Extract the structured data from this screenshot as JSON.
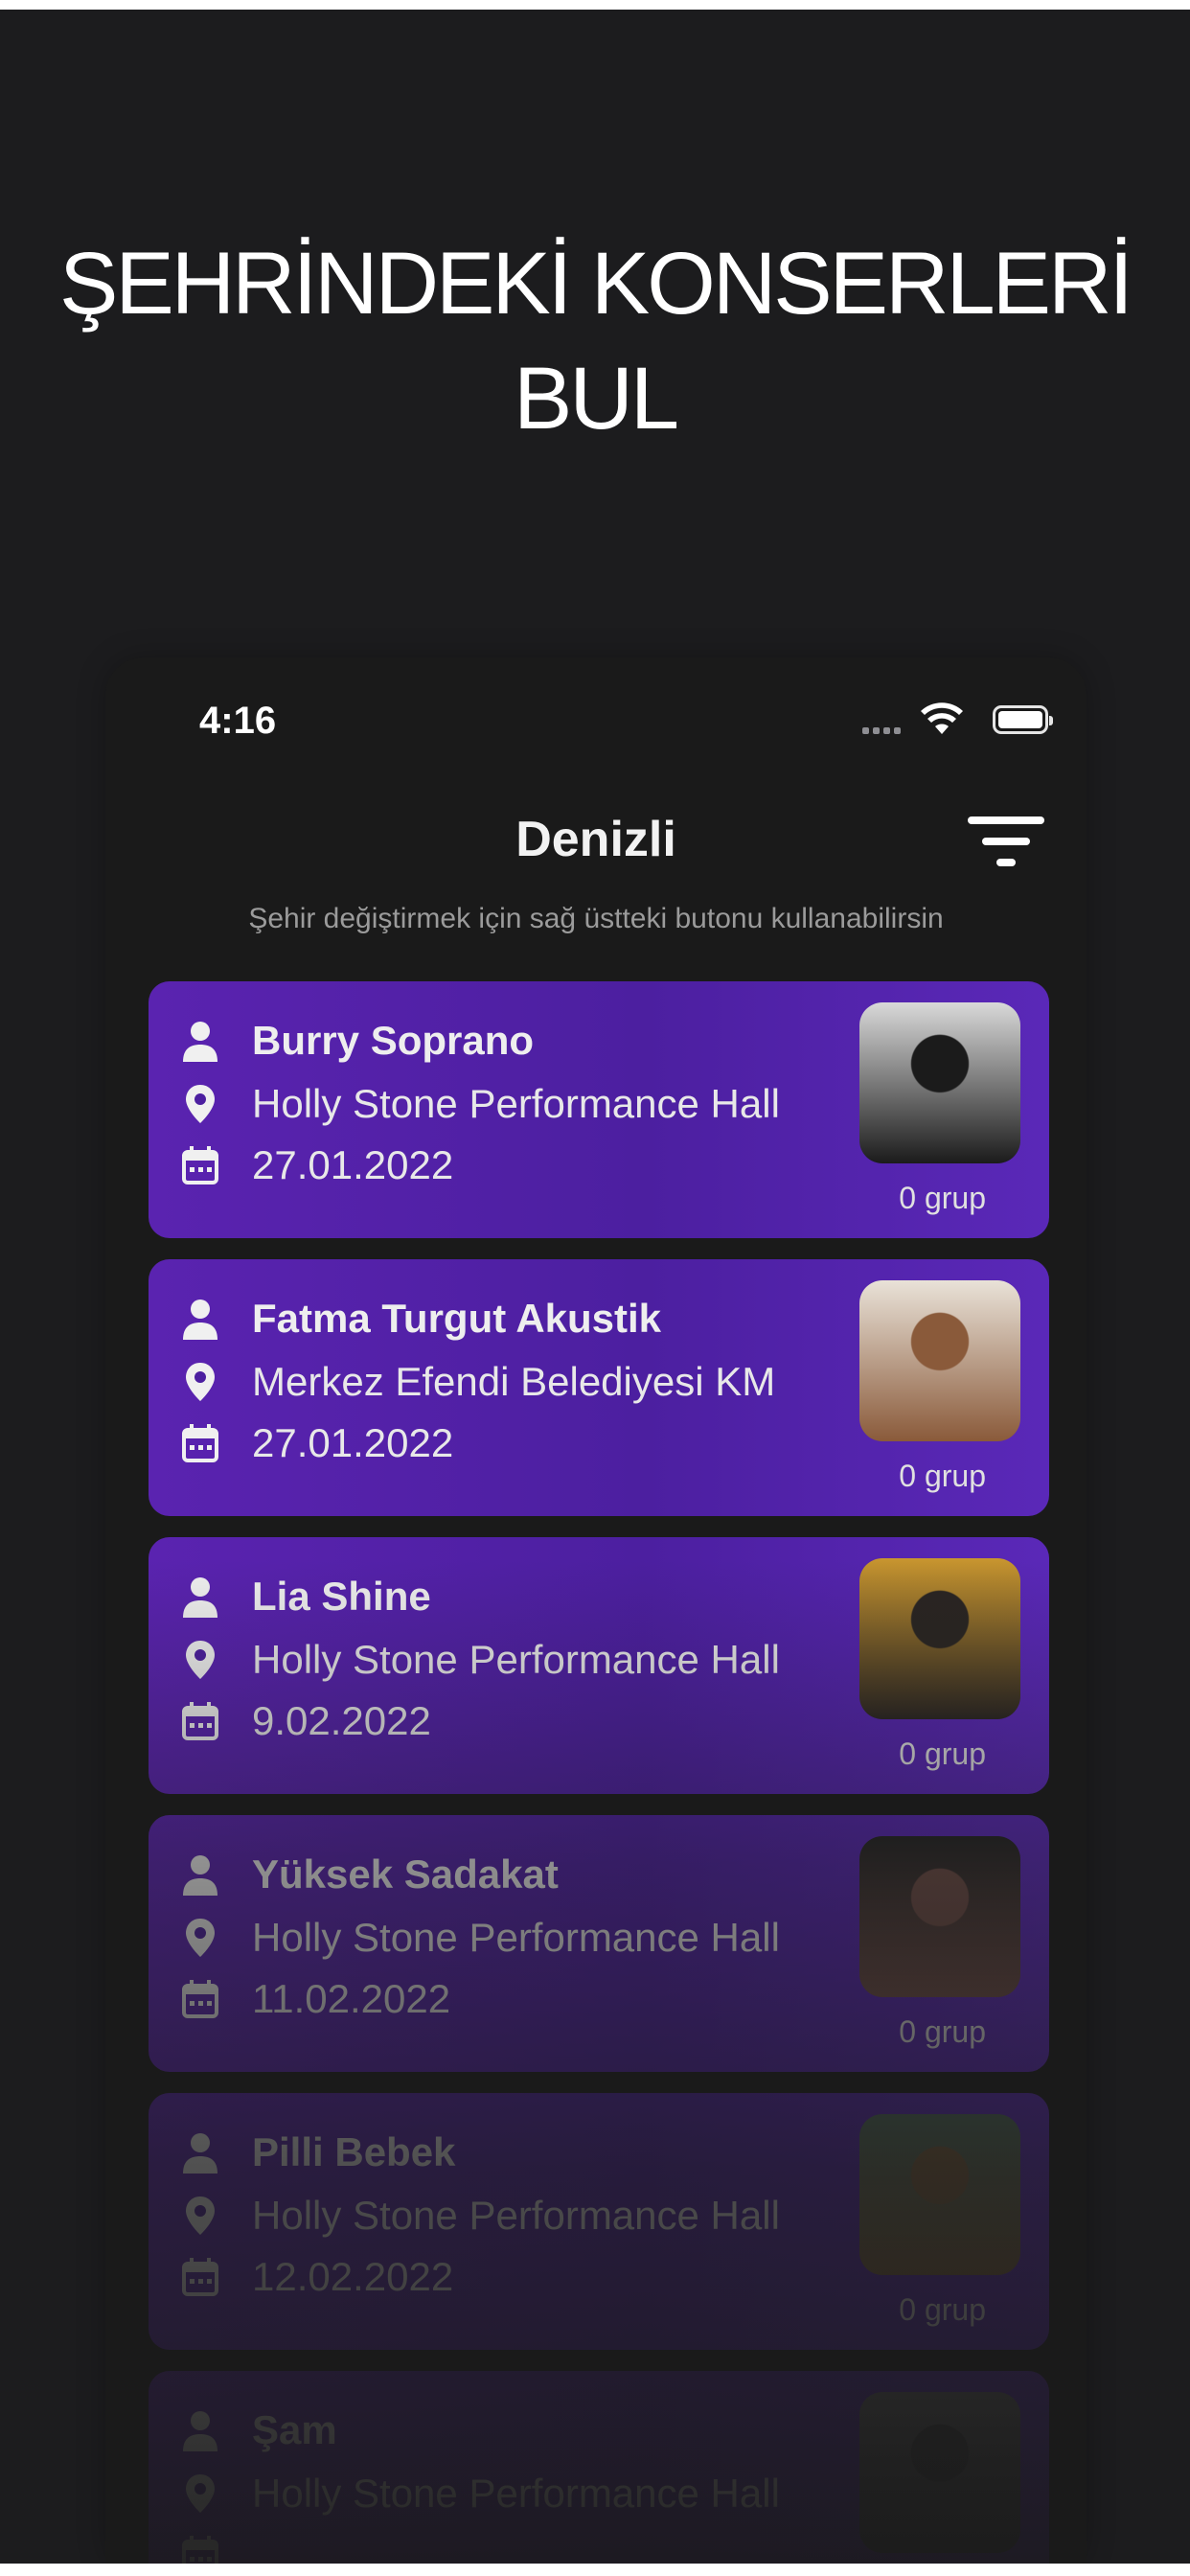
{
  "promo": {
    "title_line1": "ŞEHRİNDEKİ KONSERLERİ",
    "title_line2": "BUL"
  },
  "status_bar": {
    "time": "4:16",
    "icons": [
      "signal-icon",
      "wifi-icon",
      "battery-icon"
    ]
  },
  "header": {
    "city": "Denizli",
    "filter_icon": "filter-icon",
    "hint": "Şehir değiştirmek için sağ üstteki butonu kullanabilirsin"
  },
  "events": [
    {
      "name": "Burry Soprano",
      "place": "Holly Stone Performance Hall",
      "date": "27.01.2022",
      "groups": "0 grup",
      "thumb_colors": [
        "#d9d9d9",
        "#1b1b1b"
      ]
    },
    {
      "name": "Fatma Turgut Akustik",
      "place": "Merkez Efendi Belediyesi KM",
      "date": "27.01.2022",
      "groups": "0 grup",
      "thumb_colors": [
        "#e9e2d8",
        "#8a5a3a"
      ]
    },
    {
      "name": "Lia Shine",
      "place": "Holly Stone Performance Hall",
      "date": "9.02.2022",
      "groups": "0 grup",
      "thumb_colors": [
        "#c9962f",
        "#2a2522"
      ]
    },
    {
      "name": "Yüksek Sadakat",
      "place": "Holly Stone Performance Hall",
      "date": "11.02.2022",
      "groups": "0 grup",
      "thumb_colors": [
        "#222222",
        "#6b4a44"
      ]
    },
    {
      "name": "Pilli Bebek",
      "place": "Holly Stone Performance Hall",
      "date": "12.02.2022",
      "groups": "0 grup",
      "thumb_colors": [
        "#4e6b5a",
        "#7a5d3a"
      ]
    },
    {
      "name": "Şam",
      "place": "Holly Stone Performance Hall",
      "date": "",
      "groups": "",
      "thumb_colors": [
        "#6a6a6a",
        "#3a3a3a"
      ]
    }
  ]
}
